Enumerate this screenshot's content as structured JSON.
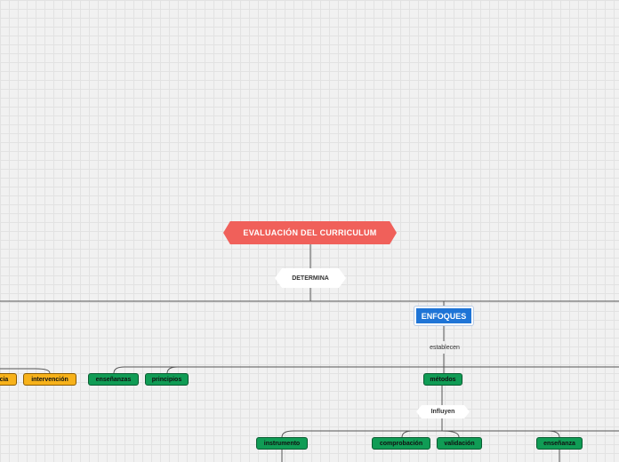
{
  "map": {
    "root": "EVALUACIÓN DEL CURRICULUM",
    "root_link": "DETERMINA",
    "enfoques": "ENFOQUES",
    "enfoques_link": "establecen",
    "left_nodes": [
      "acia",
      "intervención"
    ],
    "center_nodes": [
      "enseñanzas",
      "principios"
    ],
    "metodos": "métodos",
    "metodos_link": "Influyen",
    "bottom_nodes": [
      "instrumento",
      "comprobación",
      "validación",
      "enseñanza"
    ]
  },
  "colors": {
    "root": "#f0605a",
    "enfoques": "#1e74d6",
    "green_node": "#109c55",
    "orange_node": "#f7b21a",
    "background": "#f1f1f1",
    "connector": "#555555"
  }
}
